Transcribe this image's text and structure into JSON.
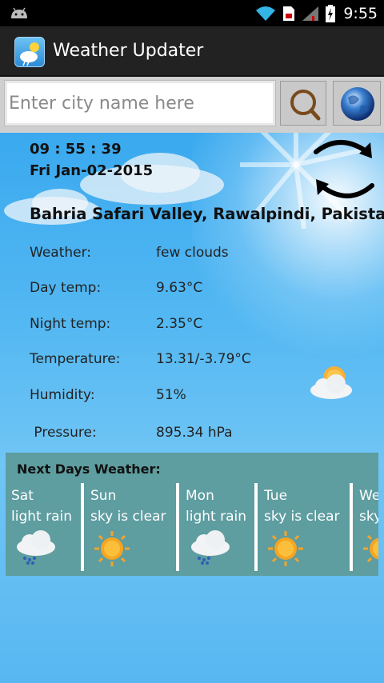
{
  "status_bar": {
    "time": "9:55"
  },
  "app": {
    "title": "Weather Updater"
  },
  "search": {
    "placeholder": "Enter city name here"
  },
  "current": {
    "time": "09 : 55 : 39",
    "date": "Fri Jan-02-2015",
    "location": "Bahria Safari Valley, Rawalpindi, Pakistan"
  },
  "details": [
    {
      "label": "Weather:",
      "value": "few clouds"
    },
    {
      "label": "Day temp:",
      "value": "9.63°C"
    },
    {
      "label": "Night temp:",
      "value": "2.35°C"
    },
    {
      "label": "Temperature:",
      "value": "13.31/-3.79°C"
    },
    {
      "label": "Humidity:",
      "value": "51%"
    },
    {
      "label": " Pressure:",
      "value": "895.34 hPa"
    }
  ],
  "forecast": {
    "title": "Next Days Weather:",
    "days": [
      {
        "day": "Sat",
        "condition": "light rain",
        "icon": "rain-cloud-icon"
      },
      {
        "day": "Sun",
        "condition": "sky is clear",
        "icon": "sun-icon"
      },
      {
        "day": "Mon",
        "condition": "light rain",
        "icon": "rain-cloud-icon"
      },
      {
        "day": "Tue",
        "condition": "sky is clear",
        "icon": "sun-icon"
      },
      {
        "day": "Wed",
        "condition": "sky is clear",
        "icon": "sun-icon"
      }
    ]
  },
  "colors": {
    "status_bar": "#000000",
    "action_bar": "#222222",
    "sky": "#54b8f2",
    "forecast_panel": "#5e9da0",
    "wifi": "#33b5e5"
  }
}
